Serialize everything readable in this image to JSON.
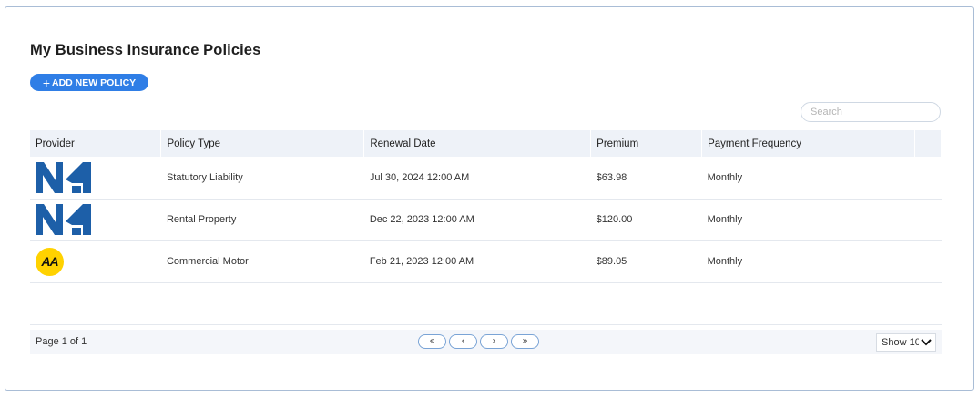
{
  "page": {
    "title": "My Business Insurance Policies",
    "add_button_label": "ADD NEW POLICY",
    "add_button_icon": "+",
    "search_placeholder": "Search"
  },
  "colors": {
    "accent": "#2f7ee6",
    "nz_logo_blue": "#1d5fa8",
    "aa_logo_yellow": "#ffd200",
    "header_bg": "#eef2f8"
  },
  "table": {
    "columns": [
      "Provider",
      "Policy Type",
      "Renewal Date",
      "Premium",
      "Payment Frequency"
    ],
    "rows": [
      {
        "provider_logo": "nzi-logo",
        "policy_type": "Statutory Liability",
        "renewal_date": "Jul 30, 2024 12:00 AM",
        "premium": "$63.98",
        "frequency": "Monthly"
      },
      {
        "provider_logo": "nzi-logo",
        "policy_type": "Rental Property",
        "renewal_date": "Dec 22, 2023 12:00 AM",
        "premium": "$120.00",
        "frequency": "Monthly"
      },
      {
        "provider_logo": "aa-logo",
        "policy_type": "Commercial Motor",
        "renewal_date": "Feb 21, 2023 12:00 AM",
        "premium": "$89.05",
        "frequency": "Monthly"
      }
    ],
    "aa_logo_text": "AA"
  },
  "footer": {
    "page_info": "Page 1 of 1",
    "pager": {
      "first": "«",
      "prev": "‹",
      "next": "›",
      "last": "»"
    },
    "show_label": "Show 10"
  }
}
